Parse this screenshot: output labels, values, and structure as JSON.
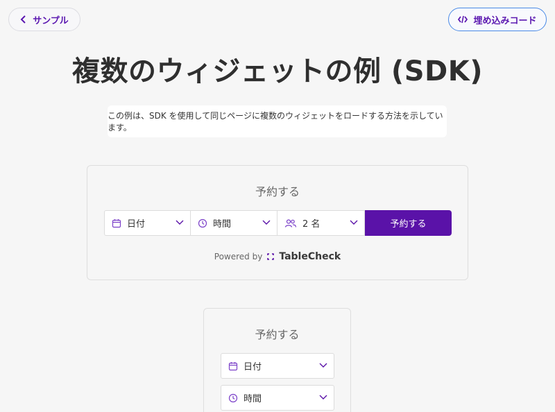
{
  "nav": {
    "back_label": "サンプル",
    "embed_label": "埋め込みコード"
  },
  "page": {
    "title": "複数のウィジェットの例 (SDK)",
    "description": "この例は、SDK を使用して同じページに複数のウィジェットをロードする方法を示しています。"
  },
  "widget_horizontal": {
    "title": "予約する",
    "date_label": "日付",
    "time_label": "時間",
    "party_label": "2 名",
    "submit_label": "予約する",
    "powered_by": "Powered by",
    "brand": "TableCheck"
  },
  "widget_vertical": {
    "title": "予約する",
    "date_label": "日付",
    "time_label": "時間"
  },
  "colors": {
    "accent": "#5a12a8",
    "icon_purple": "#7a3fc8",
    "embed_border": "#4a8ae6"
  },
  "icons": [
    "chevron-left-icon",
    "code-icon",
    "calendar-icon",
    "clock-icon",
    "people-icon",
    "chevron-down-icon",
    "tablecheck-logo-icon"
  ]
}
